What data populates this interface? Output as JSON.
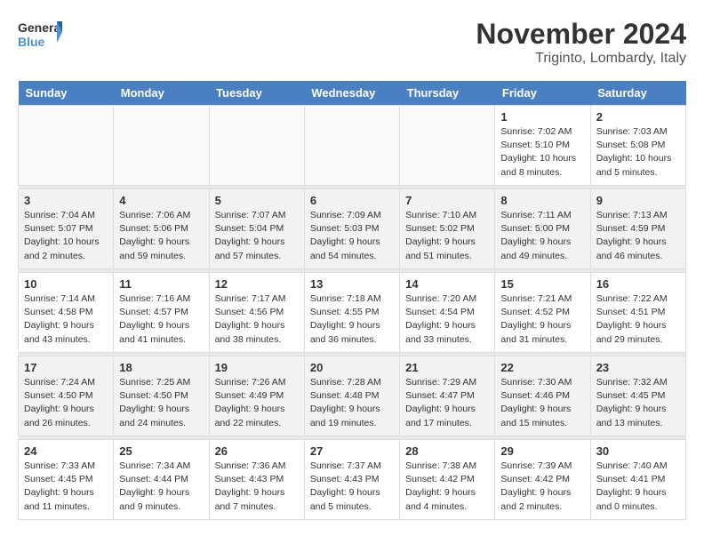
{
  "logo": {
    "text_general": "General",
    "text_blue": "Blue"
  },
  "title": "November 2024",
  "location": "Triginto, Lombardy, Italy",
  "weekdays": [
    "Sunday",
    "Monday",
    "Tuesday",
    "Wednesday",
    "Thursday",
    "Friday",
    "Saturday"
  ],
  "weeks": [
    [
      {
        "day": "",
        "info": ""
      },
      {
        "day": "",
        "info": ""
      },
      {
        "day": "",
        "info": ""
      },
      {
        "day": "",
        "info": ""
      },
      {
        "day": "",
        "info": ""
      },
      {
        "day": "1",
        "info": "Sunrise: 7:02 AM\nSunset: 5:10 PM\nDaylight: 10 hours and 8 minutes."
      },
      {
        "day": "2",
        "info": "Sunrise: 7:03 AM\nSunset: 5:08 PM\nDaylight: 10 hours and 5 minutes."
      }
    ],
    [
      {
        "day": "3",
        "info": "Sunrise: 7:04 AM\nSunset: 5:07 PM\nDaylight: 10 hours and 2 minutes."
      },
      {
        "day": "4",
        "info": "Sunrise: 7:06 AM\nSunset: 5:06 PM\nDaylight: 9 hours and 59 minutes."
      },
      {
        "day": "5",
        "info": "Sunrise: 7:07 AM\nSunset: 5:04 PM\nDaylight: 9 hours and 57 minutes."
      },
      {
        "day": "6",
        "info": "Sunrise: 7:09 AM\nSunset: 5:03 PM\nDaylight: 9 hours and 54 minutes."
      },
      {
        "day": "7",
        "info": "Sunrise: 7:10 AM\nSunset: 5:02 PM\nDaylight: 9 hours and 51 minutes."
      },
      {
        "day": "8",
        "info": "Sunrise: 7:11 AM\nSunset: 5:00 PM\nDaylight: 9 hours and 49 minutes."
      },
      {
        "day": "9",
        "info": "Sunrise: 7:13 AM\nSunset: 4:59 PM\nDaylight: 9 hours and 46 minutes."
      }
    ],
    [
      {
        "day": "10",
        "info": "Sunrise: 7:14 AM\nSunset: 4:58 PM\nDaylight: 9 hours and 43 minutes."
      },
      {
        "day": "11",
        "info": "Sunrise: 7:16 AM\nSunset: 4:57 PM\nDaylight: 9 hours and 41 minutes."
      },
      {
        "day": "12",
        "info": "Sunrise: 7:17 AM\nSunset: 4:56 PM\nDaylight: 9 hours and 38 minutes."
      },
      {
        "day": "13",
        "info": "Sunrise: 7:18 AM\nSunset: 4:55 PM\nDaylight: 9 hours and 36 minutes."
      },
      {
        "day": "14",
        "info": "Sunrise: 7:20 AM\nSunset: 4:54 PM\nDaylight: 9 hours and 33 minutes."
      },
      {
        "day": "15",
        "info": "Sunrise: 7:21 AM\nSunset: 4:52 PM\nDaylight: 9 hours and 31 minutes."
      },
      {
        "day": "16",
        "info": "Sunrise: 7:22 AM\nSunset: 4:51 PM\nDaylight: 9 hours and 29 minutes."
      }
    ],
    [
      {
        "day": "17",
        "info": "Sunrise: 7:24 AM\nSunset: 4:50 PM\nDaylight: 9 hours and 26 minutes."
      },
      {
        "day": "18",
        "info": "Sunrise: 7:25 AM\nSunset: 4:50 PM\nDaylight: 9 hours and 24 minutes."
      },
      {
        "day": "19",
        "info": "Sunrise: 7:26 AM\nSunset: 4:49 PM\nDaylight: 9 hours and 22 minutes."
      },
      {
        "day": "20",
        "info": "Sunrise: 7:28 AM\nSunset: 4:48 PM\nDaylight: 9 hours and 19 minutes."
      },
      {
        "day": "21",
        "info": "Sunrise: 7:29 AM\nSunset: 4:47 PM\nDaylight: 9 hours and 17 minutes."
      },
      {
        "day": "22",
        "info": "Sunrise: 7:30 AM\nSunset: 4:46 PM\nDaylight: 9 hours and 15 minutes."
      },
      {
        "day": "23",
        "info": "Sunrise: 7:32 AM\nSunset: 4:45 PM\nDaylight: 9 hours and 13 minutes."
      }
    ],
    [
      {
        "day": "24",
        "info": "Sunrise: 7:33 AM\nSunset: 4:45 PM\nDaylight: 9 hours and 11 minutes."
      },
      {
        "day": "25",
        "info": "Sunrise: 7:34 AM\nSunset: 4:44 PM\nDaylight: 9 hours and 9 minutes."
      },
      {
        "day": "26",
        "info": "Sunrise: 7:36 AM\nSunset: 4:43 PM\nDaylight: 9 hours and 7 minutes."
      },
      {
        "day": "27",
        "info": "Sunrise: 7:37 AM\nSunset: 4:43 PM\nDaylight: 9 hours and 5 minutes."
      },
      {
        "day": "28",
        "info": "Sunrise: 7:38 AM\nSunset: 4:42 PM\nDaylight: 9 hours and 4 minutes."
      },
      {
        "day": "29",
        "info": "Sunrise: 7:39 AM\nSunset: 4:42 PM\nDaylight: 9 hours and 2 minutes."
      },
      {
        "day": "30",
        "info": "Sunrise: 7:40 AM\nSunset: 4:41 PM\nDaylight: 9 hours and 0 minutes."
      }
    ]
  ]
}
